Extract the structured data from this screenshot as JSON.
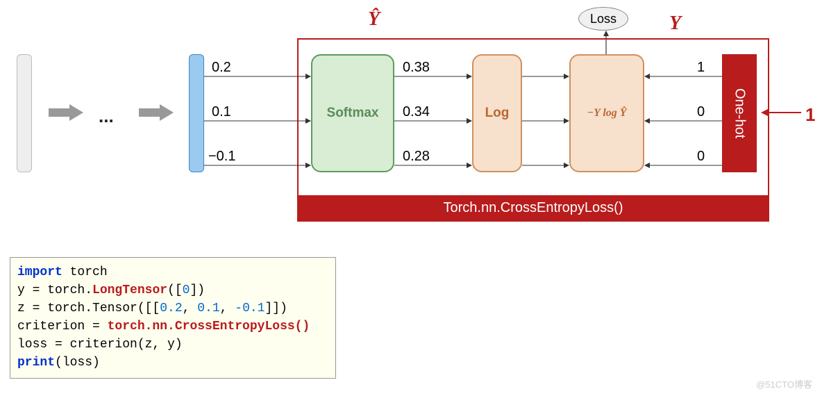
{
  "labels": {
    "yhat": "Ŷ",
    "y": "Y",
    "loss": "Loss",
    "softmax": "Softmax",
    "log": "Log",
    "nll": "−Y log Ŷ",
    "onehot": "One-hot",
    "footer": "Torch.nn.CrossEntropyLoss()",
    "dots": "...",
    "input_class": "1"
  },
  "logits": [
    "0.2",
    "0.1",
    "−0.1"
  ],
  "probs": [
    "0.38",
    "0.34",
    "0.28"
  ],
  "onehot_values": [
    "1",
    "0",
    "0"
  ],
  "code": {
    "import_kw": "import",
    "import_mod": " torch",
    "line2a": "y = torch.",
    "longtensor": "LongTensor",
    "line2b": "([",
    "line2c": "0",
    "line2d": "])",
    "line3a": "z = torch.Tensor([[",
    "z0": "0.2",
    "sep": ", ",
    "z1": "0.1",
    "z2": "-0.1",
    "line3b": "]])",
    "line4a": "criterion = ",
    "cel": "torch.nn.CrossEntropyLoss()",
    "line5": "loss = criterion(z, y)",
    "line6a": "print",
    "line6b": "(loss)"
  },
  "watermark": "@51CTO博客"
}
